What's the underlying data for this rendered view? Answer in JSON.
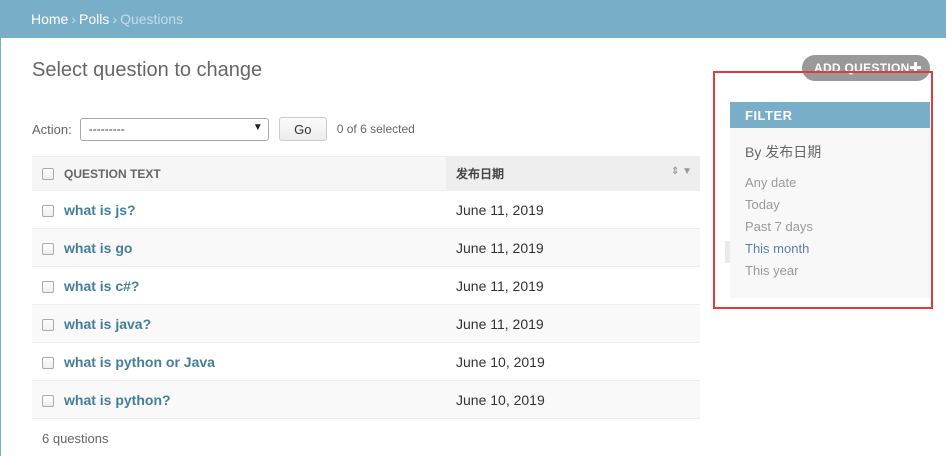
{
  "breadcrumb": {
    "home": "Home",
    "app": "Polls",
    "current": "Questions"
  },
  "title": "Select question to change",
  "add_button": {
    "label": "ADD QUESTION",
    "icon": "plus-icon"
  },
  "actions": {
    "label": "Action:",
    "selected": "---------",
    "go": "Go",
    "counter": "0 of 6 selected"
  },
  "table": {
    "headers": {
      "question_text": "QUESTION TEXT",
      "pub_date": "发布日期"
    },
    "rows": [
      {
        "question": "what is js?",
        "date": "June 11, 2019"
      },
      {
        "question": "what is go",
        "date": "June 11, 2019"
      },
      {
        "question": "what is c#?",
        "date": "June 11, 2019"
      },
      {
        "question": "what is java?",
        "date": "June 11, 2019"
      },
      {
        "question": "what is python or Java",
        "date": "June 10, 2019"
      },
      {
        "question": "what is python?",
        "date": "June 10, 2019"
      }
    ]
  },
  "paginator": "6 questions",
  "filter": {
    "title": "FILTER",
    "group": "By 发布日期",
    "options": [
      "Any date",
      "Today",
      "Past 7 days",
      "This month",
      "This year"
    ],
    "selected_index": 3
  },
  "colors": {
    "header": "#79aec8",
    "link": "#447e9b",
    "highlight": "#e33b3b"
  }
}
